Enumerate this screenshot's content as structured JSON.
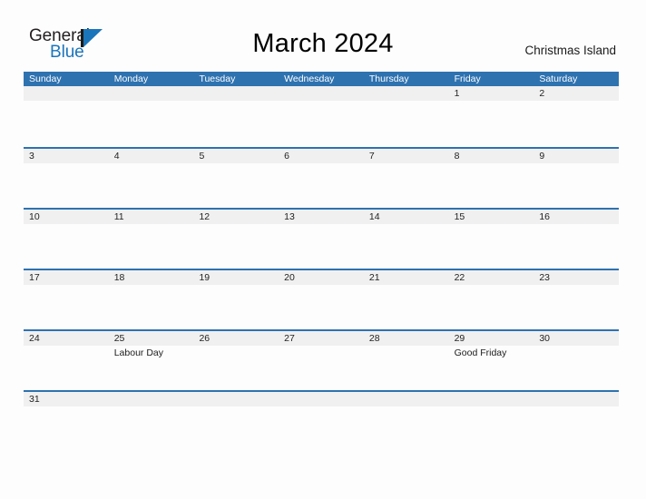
{
  "brand": {
    "name_part1": "General",
    "name_part2": "Blue",
    "flag_icon": "triangle-flag-icon",
    "accent_color": "#1b75bb"
  },
  "header": {
    "title": "March 2024",
    "location": "Christmas Island"
  },
  "theme": {
    "header_blue": "#2e72b0",
    "band_gray": "#f0f0f0",
    "page_background": "#fdfdfd"
  },
  "calendar": {
    "month": "March",
    "year": "2024",
    "weekdays": [
      "Sunday",
      "Monday",
      "Tuesday",
      "Wednesday",
      "Thursday",
      "Friday",
      "Saturday"
    ],
    "weeks": [
      {
        "days": [
          {
            "number": "",
            "event": ""
          },
          {
            "number": "",
            "event": ""
          },
          {
            "number": "",
            "event": ""
          },
          {
            "number": "",
            "event": ""
          },
          {
            "number": "",
            "event": ""
          },
          {
            "number": "1",
            "event": ""
          },
          {
            "number": "2",
            "event": ""
          }
        ]
      },
      {
        "days": [
          {
            "number": "3",
            "event": ""
          },
          {
            "number": "4",
            "event": ""
          },
          {
            "number": "5",
            "event": ""
          },
          {
            "number": "6",
            "event": ""
          },
          {
            "number": "7",
            "event": ""
          },
          {
            "number": "8",
            "event": ""
          },
          {
            "number": "9",
            "event": ""
          }
        ]
      },
      {
        "days": [
          {
            "number": "10",
            "event": ""
          },
          {
            "number": "11",
            "event": ""
          },
          {
            "number": "12",
            "event": ""
          },
          {
            "number": "13",
            "event": ""
          },
          {
            "number": "14",
            "event": ""
          },
          {
            "number": "15",
            "event": ""
          },
          {
            "number": "16",
            "event": ""
          }
        ]
      },
      {
        "days": [
          {
            "number": "17",
            "event": ""
          },
          {
            "number": "18",
            "event": ""
          },
          {
            "number": "19",
            "event": ""
          },
          {
            "number": "20",
            "event": ""
          },
          {
            "number": "21",
            "event": ""
          },
          {
            "number": "22",
            "event": ""
          },
          {
            "number": "23",
            "event": ""
          }
        ]
      },
      {
        "days": [
          {
            "number": "24",
            "event": ""
          },
          {
            "number": "25",
            "event": "Labour Day"
          },
          {
            "number": "26",
            "event": ""
          },
          {
            "number": "27",
            "event": ""
          },
          {
            "number": "28",
            "event": ""
          },
          {
            "number": "29",
            "event": "Good Friday"
          },
          {
            "number": "30",
            "event": ""
          }
        ]
      },
      {
        "days": [
          {
            "number": "31",
            "event": ""
          },
          {
            "number": "",
            "event": ""
          },
          {
            "number": "",
            "event": ""
          },
          {
            "number": "",
            "event": ""
          },
          {
            "number": "",
            "event": ""
          },
          {
            "number": "",
            "event": ""
          },
          {
            "number": "",
            "event": ""
          }
        ]
      }
    ]
  }
}
